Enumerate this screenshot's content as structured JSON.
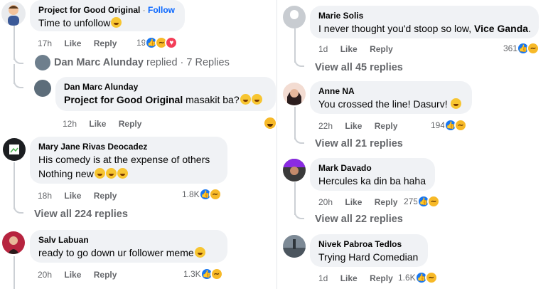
{
  "common": {
    "like": "Like",
    "reply": "Reply"
  },
  "left": {
    "c1": {
      "author": "Project for Good Original",
      "sep": " · ",
      "follow": "Follow",
      "text": "Time to unfollow",
      "time": "17h",
      "count": "19"
    },
    "replied": {
      "name": "Dan Marc Alunday",
      "text": " replied · 7 Replies"
    },
    "c2": {
      "author": "Dan Marc Alunday",
      "mention": "Project for Good Original",
      "text": " masakit ba?",
      "time": "12h"
    },
    "c3": {
      "author": "Mary Jane Rivas Deocadez",
      "line1": "His comedy is at the expense of others",
      "line2": "Nothing new",
      "time": "18h",
      "count": "1.8K",
      "view_all": "View all 224 replies"
    },
    "c4": {
      "author": "Salv Labuan",
      "text": "ready to go down ur follower meme",
      "time": "20h",
      "count": "1.3K"
    }
  },
  "right": {
    "r1": {
      "author": "Marie Solis",
      "text": "I never thought you'd stoop so low, ",
      "mention": "Vice Ganda",
      "tail": ".",
      "time": "1d",
      "count": "361",
      "view_all": "View all 45 replies"
    },
    "r2": {
      "author": "Anne NA",
      "text": "You crossed the line! Dasurv! ",
      "time": "22h",
      "count": "194",
      "view_all": "View all 21 replies"
    },
    "r3": {
      "author": "Mark Davado",
      "text": "Hercules ka din ba haha",
      "time": "20h",
      "count": "275",
      "view_all": "View all 22 replies"
    },
    "r4": {
      "author": "Nivek Pabroa Tedlos",
      "text": "Trying Hard Comedian",
      "time": "1d",
      "count": "1.6K"
    }
  }
}
